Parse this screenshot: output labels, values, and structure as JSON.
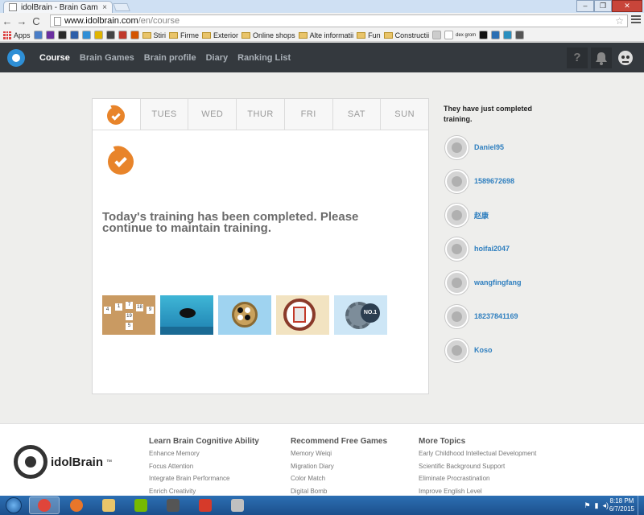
{
  "browser": {
    "tab_title": "idolBrain - Brain Games &",
    "tab_close": "×",
    "url_host": "www.idolbrain.com",
    "url_path": "/en/course",
    "back": "←",
    "forward": "→",
    "reload": "C",
    "star": "☆",
    "window_minimize": "–",
    "window_restore": "❐",
    "window_close": "✕",
    "bookmarks": [
      {
        "label": "Apps",
        "type": "apps"
      },
      {
        "label": "",
        "type": "icon",
        "color": "#4a7ec8"
      },
      {
        "label": "",
        "type": "icon",
        "color": "#6b2fa0"
      },
      {
        "label": "",
        "type": "icon",
        "color": "#2a2a2a"
      },
      {
        "label": "",
        "type": "icon",
        "color": "#2d5fa8"
      },
      {
        "label": "",
        "type": "icon",
        "color": "#2f8ed6"
      },
      {
        "label": "",
        "type": "icon",
        "color": "#e0b400"
      },
      {
        "label": "",
        "type": "icon",
        "color": "#444"
      },
      {
        "label": "",
        "type": "icon",
        "color": "#c0392b"
      },
      {
        "label": "",
        "type": "icon",
        "color": "#d35400"
      },
      {
        "label": "Stiri",
        "type": "folder"
      },
      {
        "label": "Firme",
        "type": "folder"
      },
      {
        "label": "Exterior",
        "type": "folder"
      },
      {
        "label": "Online shops",
        "type": "folder"
      },
      {
        "label": "Alte informatii",
        "type": "folder"
      },
      {
        "label": "Fun",
        "type": "folder"
      },
      {
        "label": "Constructii",
        "type": "folder"
      },
      {
        "label": "",
        "type": "icon",
        "color": "#ccc"
      },
      {
        "label": "dex grom",
        "type": "icon",
        "color": "#fff"
      },
      {
        "label": "",
        "type": "icon",
        "color": "#111"
      },
      {
        "label": "",
        "type": "icon",
        "color": "#2c6fb3"
      },
      {
        "label": "",
        "type": "icon",
        "color": "#2a8fbf"
      },
      {
        "label": "",
        "type": "icon",
        "color": "#555"
      }
    ]
  },
  "site": {
    "nav": [
      "Course",
      "Brain Games",
      "Brain profile",
      "Diary",
      "Ranking List"
    ],
    "help_label": "?",
    "days": [
      "",
      "TUES",
      "WED",
      "THUR",
      "FRI",
      "SAT",
      "SUN"
    ],
    "completed_message": "Today's training has been completed. Please continue to maintain training.",
    "game1_numbers": [
      "4",
      "1",
      "7",
      "18",
      "9",
      "19",
      "5"
    ],
    "game5_badge": "NO.1",
    "sidebar_title": "They have just completed training.",
    "users": [
      "Daniel95",
      "1589672698",
      "赵康",
      "hoifai2047",
      "wangfingfang",
      "18237841169",
      "Koso"
    ]
  },
  "footer": {
    "logo_text": "idolBrain",
    "logo_mark": "™",
    "columns": [
      {
        "title": "Learn Brain Cognitive Ability",
        "items": [
          "Enhance Memory",
          "Focus Attention",
          "Integrate Brain Performance",
          "Enrich Creativity"
        ]
      },
      {
        "title": "Recommend Free Games",
        "items": [
          "Memory Weiqi",
          "Migration Diary",
          "Color Match",
          "Digital Bomb"
        ]
      },
      {
        "title": "More Topics",
        "items": [
          "Early Childhood Intellectual Development",
          "Scientific Background Support",
          "Eliminate Procrastination",
          "Improve English Level"
        ]
      }
    ]
  },
  "taskbar": {
    "time": "8:18 PM",
    "date": "6/7/2015",
    "apps": [
      {
        "name": "chrome",
        "color": "#e0453a"
      },
      {
        "name": "firefox",
        "color": "#e8762a"
      },
      {
        "name": "explorer",
        "color": "#e8c56a"
      },
      {
        "name": "nvidia",
        "color": "#76b900"
      },
      {
        "name": "media",
        "color": "#555"
      },
      {
        "name": "speed",
        "color": "#d63a2a"
      },
      {
        "name": "grid",
        "color": "#c0c0c0"
      }
    ]
  }
}
